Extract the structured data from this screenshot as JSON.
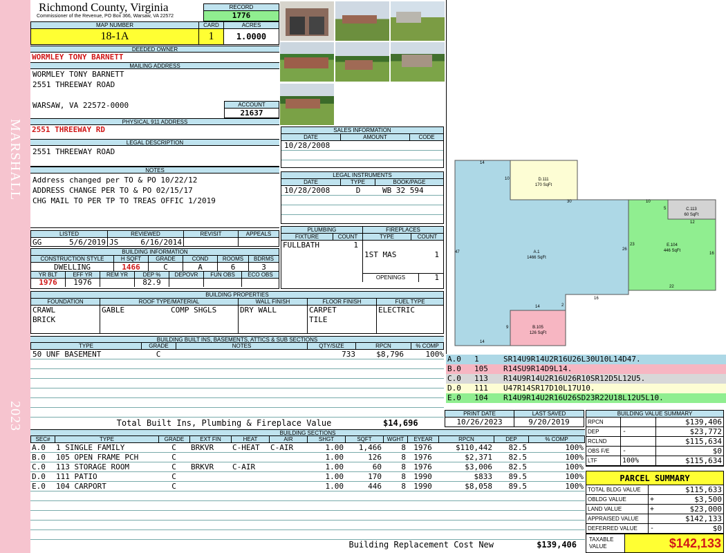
{
  "sidebar": {
    "district": "MARSHALL",
    "year": "2023"
  },
  "header": {
    "county": "Richmond County, Virginia",
    "commissioner": "Commissioner of the Revenue, PO Box 366, Warsaw, VA 22572",
    "record_label": "RECORD",
    "record": "1776",
    "map_label": "MAP NUMBER",
    "map": "18-1A",
    "card_label": "CARD",
    "card": "1",
    "acres_label": "ACRES",
    "acres": "1.0000"
  },
  "owner": {
    "deeded_label": "DEEDED OWNER",
    "deeded": "WORMLEY TONY BARNETT",
    "mailing_label": "MAILING ADDRESS",
    "mail_line1": "WORMLEY TONY BARNETT",
    "mail_line2": "2551 THREEWAY ROAD",
    "mail_line3": "WARSAW, VA 22572-0000",
    "account_label": "ACCOUNT",
    "account": "21637",
    "physical_label": "PHYSICAL 911 ADDRESS",
    "physical": "2551 THREEWAY RD",
    "legal_label": "LEGAL DESCRIPTION",
    "legal": "2551 THREEWAY ROAD",
    "notes_label": "NOTES",
    "notes": [
      "Address changed per TO & PO 10/22/12",
      "ADDRESS CHANGE PER TO & PO 02/15/17",
      "CHG MAIL TO PER TP TO TREAS OFFIC 1/2019"
    ]
  },
  "listing": {
    "labels": [
      "LISTED",
      "REVIEWED",
      "REVISIT",
      "APPEALS"
    ],
    "listed_by": "GG",
    "listed_date": "5/6/2019",
    "reviewed_by": "JS",
    "reviewed_date": "6/16/2014"
  },
  "building_info": {
    "title": "BUILDING INFORMATION",
    "labels1": [
      "CONSTRUCTION STYLE",
      "H SQFT",
      "GRADE",
      "COND",
      "ROOMS",
      "BDRMS"
    ],
    "values1": [
      "DWELLING",
      "1466",
      "C",
      "A",
      "6",
      "3"
    ],
    "labels2": [
      "YR BLT",
      "EFF YR",
      "REM YR",
      "DEP %",
      "DEPOVR",
      "FUN OBS",
      "ECO OBS"
    ],
    "values2": [
      "1976",
      "1976",
      "",
      "82.9",
      "",
      "",
      ""
    ]
  },
  "building_props": {
    "title": "BUILDING PROPERTIES",
    "labels": [
      "FOUNDATION",
      "ROOF TYPE/MATERIAL",
      "WALL FINISH",
      "FLOOR FINISH",
      "FUEL TYPE"
    ],
    "foundation1": "CRAWL",
    "foundation2": "BRICK",
    "roof_type": "GABLE",
    "roof_mat": "COMP SHGLS",
    "wall": "DRY WALL",
    "floor1": "CARPET",
    "floor2": "TILE",
    "fuel": "ELECTRIC"
  },
  "builtins": {
    "title": "BUILDING BUILT INS, BASEMENTS, ATTICS & SUB SECTIONS",
    "labels": [
      "TYPE",
      "GRADE",
      "NOTES",
      "QTY/SIZE",
      "RPCN",
      "% COMP"
    ],
    "row": [
      "50 UNF BASEMENT",
      "C",
      "",
      "733",
      "$8,796",
      "100%"
    ],
    "total_label": "Total Built Ins, Plumbing & Fireplace Value",
    "total": "$14,696"
  },
  "sales": {
    "title": "SALES INFORMATION",
    "labels": [
      "DATE",
      "AMOUNT",
      "CODE"
    ],
    "date": "10/28/2008"
  },
  "legal_instr": {
    "title": "LEGAL INSTRUMENTS",
    "labels": [
      "DATE",
      "TYPE",
      "BOOK/PAGE"
    ],
    "row": [
      "10/28/2008",
      "D",
      "WB 32 594"
    ]
  },
  "plumbing": {
    "title": "PLUMBING",
    "labels": [
      "FIXTURE",
      "COUNT"
    ],
    "fixture": "FULLBATH",
    "count": "1"
  },
  "fireplaces": {
    "title": "FIREPLACES",
    "labels": [
      "TYPE",
      "COUNT"
    ],
    "type": "1ST MAS",
    "count": "1",
    "openings_label": "OPENINGS",
    "openings": "1"
  },
  "sketch": {
    "areas": [
      {
        "code": "A.1",
        "sqft": "1466 SqFt",
        "color": "#add8e6"
      },
      {
        "code": "B.105",
        "sqft": "126 SqFt",
        "color": "#f7b6c2"
      },
      {
        "code": "C.113",
        "sqft": "60 SqFt",
        "color": "#d3d3d3"
      },
      {
        "code": "D.111",
        "sqft": "170 SqFt",
        "color": "#fdfdd4"
      },
      {
        "code": "E.104",
        "sqft": "446 SqFt",
        "color": "#90ee90"
      }
    ],
    "dims": [
      "14",
      "10",
      "30",
      "10",
      "5",
      "12",
      "47",
      "23",
      "26",
      "16",
      "22",
      "16",
      "14",
      "2",
      "9",
      "14"
    ]
  },
  "segments": [
    {
      "sec": "A.0",
      "num": "1",
      "path": "SR14U9R14U2R16U26L30U10L14D47.",
      "color": "#add8e6"
    },
    {
      "sec": "B.0",
      "num": "105",
      "path": "R14SU9R14D9L14.",
      "color": "#f7b6c2"
    },
    {
      "sec": "C.0",
      "num": "113",
      "path": "R14U9R14U2R16U26R10SR12D5L12U5.",
      "color": "#d8d8d8"
    },
    {
      "sec": "D.0",
      "num": "111",
      "path": "U47R14SR17D10L17U10.",
      "color": "#fdfdd4"
    },
    {
      "sec": "E.0",
      "num": "104",
      "path": "R14U9R14U2R16U26SD23R22U18L12U5L10.",
      "color": "#90ee90"
    }
  ],
  "dates": {
    "print_label": "PRINT DATE",
    "print": "10/26/2023",
    "saved_label": "LAST SAVED",
    "saved": "9/20/2019"
  },
  "value_summary": {
    "title": "BUILDING VALUE SUMMARY",
    "rows": [
      {
        "label": "RPCN",
        "sign": "",
        "value": "$139,406"
      },
      {
        "label": "DEP",
        "sign": "-",
        "value": "$23,772"
      },
      {
        "label": "RCLND",
        "sign": "",
        "value": "$115,634"
      },
      {
        "label": "OBS F/E",
        "sign": "-",
        "value": "$0"
      },
      {
        "label": "LTF",
        "sign": "100%",
        "value": "$115,634"
      }
    ]
  },
  "parcel": {
    "title": "PARCEL SUMMARY",
    "rows": [
      {
        "label": "TOTAL BLDG VALUE",
        "sign": "",
        "value": "$115,633"
      },
      {
        "label": "OBLDG VALUE",
        "sign": "+",
        "value": "$3,500"
      },
      {
        "label": "LAND VALUE",
        "sign": "+",
        "value": "$23,000"
      },
      {
        "label": "APPRAISED VALUE",
        "sign": "",
        "value": "$142,133"
      },
      {
        "label": "DEFERRED VALUE",
        "sign": "-",
        "value": "$0"
      }
    ],
    "taxable_label1": "TAXABLE",
    "taxable_label2": "VALUE",
    "taxable": "$142,133"
  },
  "sections": {
    "title": "BUILDING SECTIONS",
    "labels": [
      "SEC#",
      "TYPE",
      "GRADE",
      "EXT FIN",
      "HEAT",
      "AIR",
      "SHGT",
      "SQFT",
      "WGHT",
      "EYEAR",
      "RPCN",
      "DEP",
      "% COMP"
    ],
    "rows": [
      [
        "A.0",
        "1 SINGLE FAMILY",
        "C",
        "BRKVR",
        "C-HEAT",
        "C-AIR",
        "1.00",
        "1,466",
        "8",
        "1976",
        "$110,442",
        "82.5",
        "100%"
      ],
      [
        "B.0",
        "105 OPEN FRAME PCH",
        "C",
        "",
        "",
        "",
        "1.00",
        "126",
        "8",
        "1976",
        "$2,371",
        "82.5",
        "100%"
      ],
      [
        "C.0",
        "113 STORAGE ROOM",
        "C",
        "BRKVR",
        "C-AIR",
        "",
        "1.00",
        "60",
        "8",
        "1976",
        "$3,006",
        "82.5",
        "100%"
      ],
      [
        "D.0",
        "111 PATIO",
        "C",
        "",
        "",
        "",
        "1.00",
        "170",
        "8",
        "1990",
        "$833",
        "89.5",
        "100%"
      ],
      [
        "E.0",
        "104 CARPORT",
        "C",
        "",
        "",
        "",
        "1.00",
        "446",
        "8",
        "1990",
        "$8,058",
        "89.5",
        "100%"
      ]
    ],
    "rcn_label": "Building Replacement Cost New",
    "rcn": "$139,406"
  }
}
